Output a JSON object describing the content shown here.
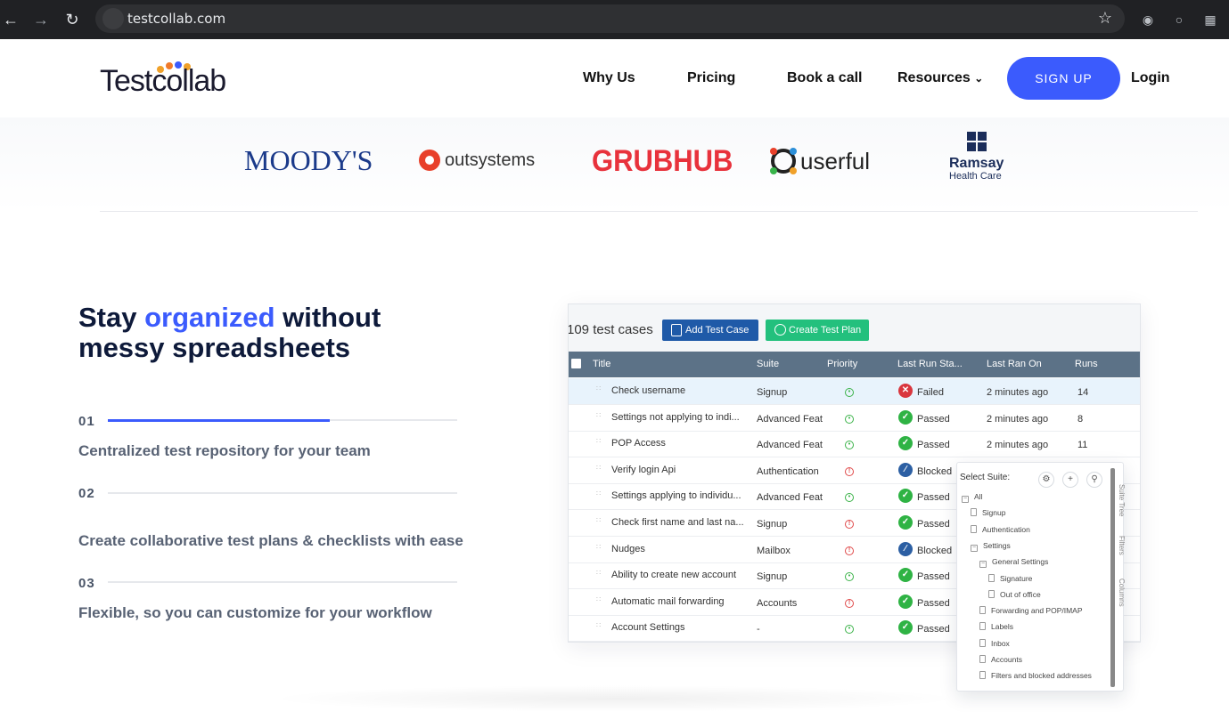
{
  "browser": {
    "url": "testcollab.com",
    "back_icon": "arrow-left-icon",
    "forward_icon": "arrow-right-icon",
    "reload_icon": "reload-icon"
  },
  "header": {
    "logo_text": "Testcollab",
    "nav": [
      "Why Us",
      "Pricing",
      "Book a call",
      "Resources"
    ],
    "signup": "SIGN UP",
    "login": "Login",
    "accent": "#3b5bfd"
  },
  "brands": {
    "moodys": "MOODY'S",
    "outsystems": "outsystems",
    "grubhub": "GRUBHUB",
    "userful": "userful",
    "ramsay_1": "Ramsay",
    "ramsay_2": "Health Care"
  },
  "hero": {
    "title_1": "Stay ",
    "title_accent": "organized",
    "title_2": " without messy spreadsheets",
    "steps": [
      {
        "num": "01",
        "text": "Centralized test repository for your team",
        "progress": 0.64
      },
      {
        "num": "02",
        "text": "Create collaborative test plans & checklists with ease",
        "progress": 0
      },
      {
        "num": "03",
        "text": "Flexible, so you can customize for your workflow",
        "progress": 0
      }
    ]
  },
  "app": {
    "count": "109 test cases",
    "add_btn": "Add Test Case",
    "plan_btn": "Create Test Plan",
    "columns": [
      "Title",
      "Suite",
      "Priority",
      "Last Run Sta...",
      "Last Ran On",
      "Runs"
    ],
    "rows": [
      {
        "title": "Check username",
        "suite": "Signup",
        "priority": "low",
        "status": "Failed",
        "last": "2 minutes ago",
        "runs": "14"
      },
      {
        "title": "Settings not applying to indi...",
        "suite": "Advanced Feat",
        "priority": "low",
        "status": "Passed",
        "last": "2 minutes ago",
        "runs": "8"
      },
      {
        "title": "POP Access",
        "suite": "Advanced Feat",
        "priority": "low",
        "status": "Passed",
        "last": "2 minutes ago",
        "runs": "11"
      },
      {
        "title": "Verify login Api",
        "suite": "Authentication",
        "priority": "high",
        "status": "Blocked",
        "last": "",
        "runs": ""
      },
      {
        "title": "Settings applying to individu...",
        "suite": "Advanced Feat",
        "priority": "low",
        "status": "Passed",
        "last": "",
        "runs": ""
      },
      {
        "title": "Check first name and last na...",
        "suite": "Signup",
        "priority": "high",
        "status": "Passed",
        "last": "",
        "runs": ""
      },
      {
        "title": "Nudges",
        "suite": "Mailbox",
        "priority": "high",
        "status": "Blocked",
        "last": "",
        "runs": ""
      },
      {
        "title": "Ability to create new account",
        "suite": "Signup",
        "priority": "low",
        "status": "Passed",
        "last": "",
        "runs": ""
      },
      {
        "title": "Automatic mail forwarding",
        "suite": "Accounts",
        "priority": "high",
        "status": "Passed",
        "last": "",
        "runs": ""
      },
      {
        "title": "Account Settings",
        "suite": "-",
        "priority": "low",
        "status": "Passed",
        "last": "",
        "runs": ""
      }
    ],
    "status_colors": {
      "Failed": "#d9363e",
      "Passed": "#2fb344",
      "Blocked": "#2c5fa3"
    },
    "priority_colors": {
      "low": "#3cb34a",
      "high": "#e04b4b"
    }
  },
  "suite_panel": {
    "title": "Select Suite:",
    "items": [
      "All",
      "Signup",
      "Authentication",
      "Settings",
      "General Settings",
      "Signature",
      "Out of office",
      "Forwarding and POP/IMAP",
      "Labels",
      "Inbox",
      "Accounts",
      "Filters and blocked addresses"
    ],
    "side_tabs": [
      "Suite Tree",
      "Filters",
      "Columns"
    ]
  }
}
